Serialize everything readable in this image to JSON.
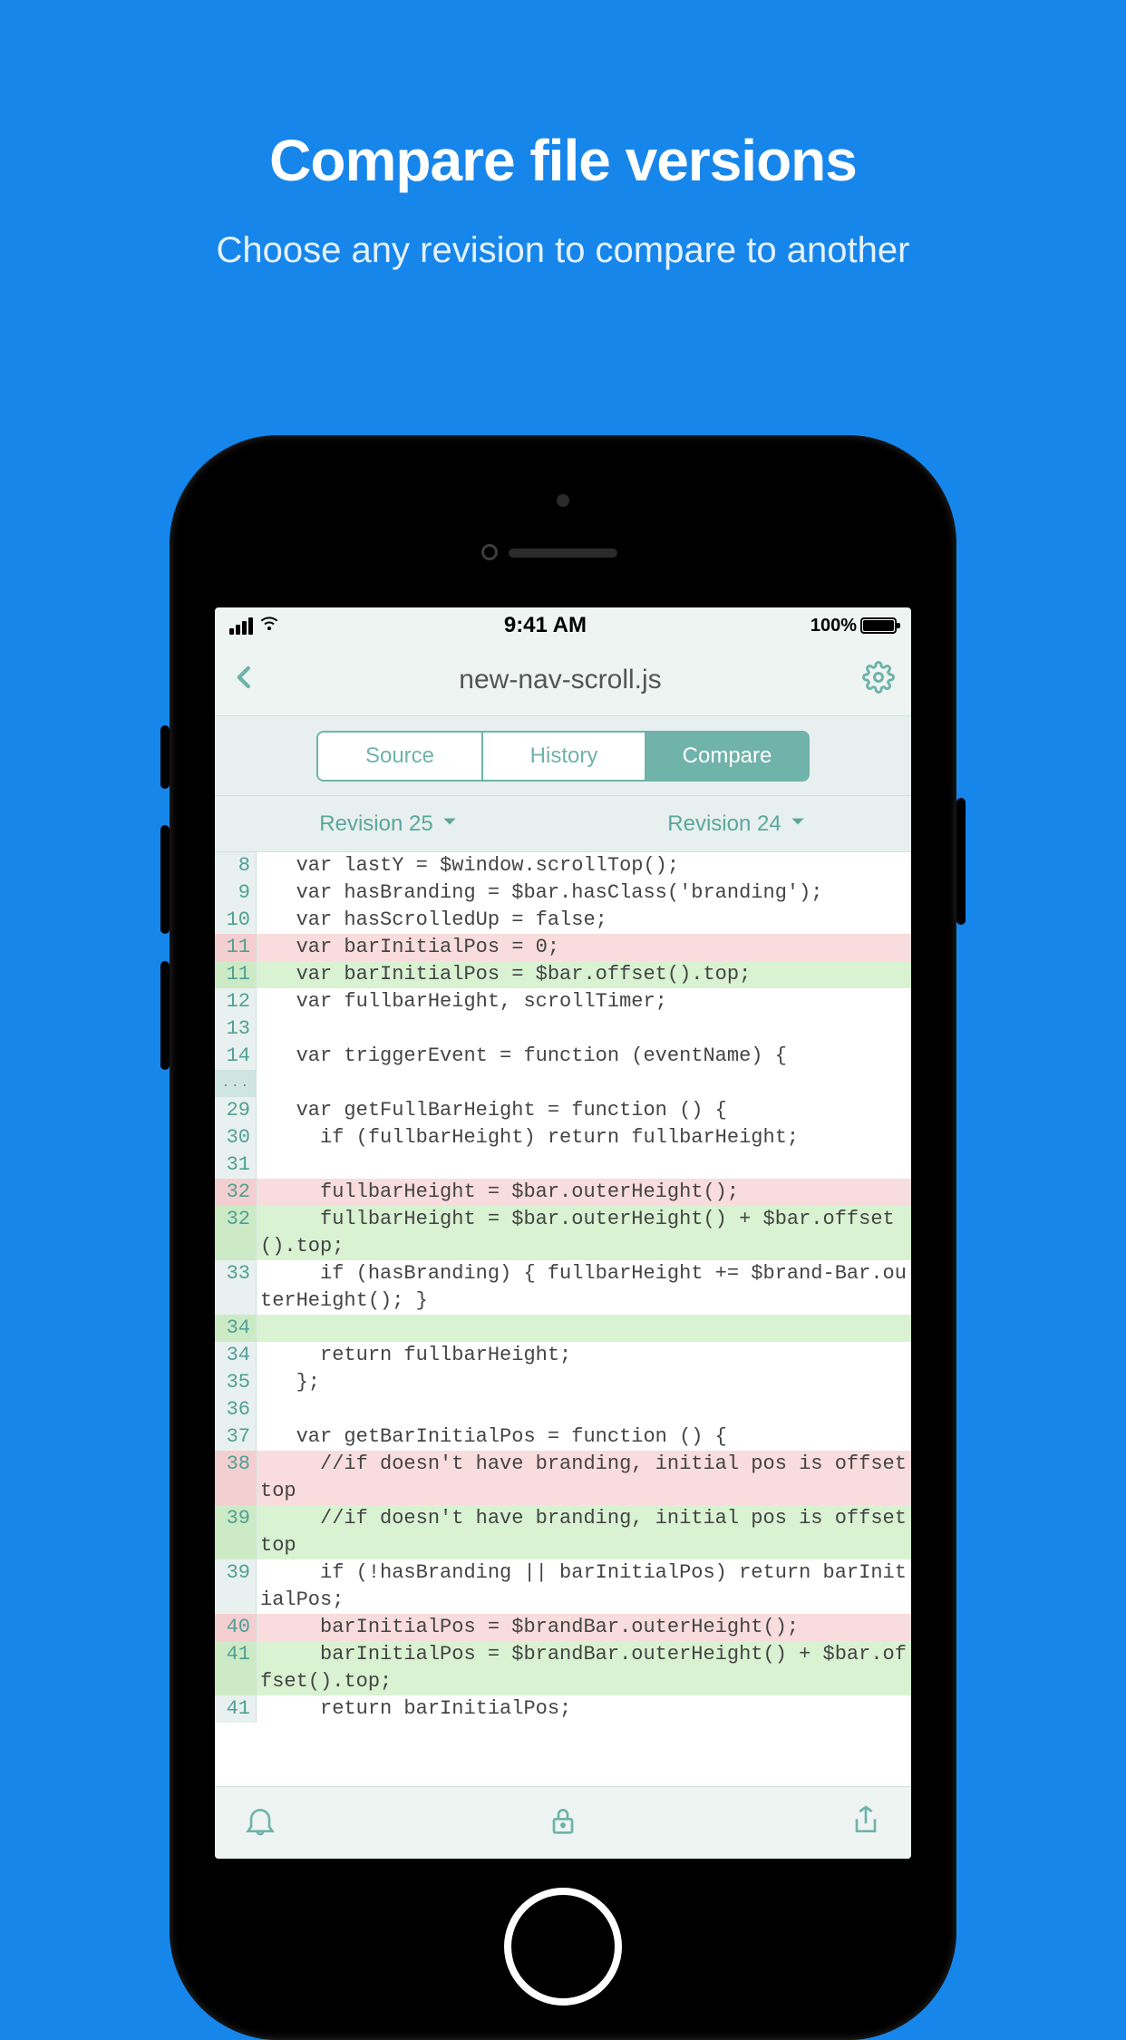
{
  "promo": {
    "title": "Compare file versions",
    "subtitle": "Choose any revision to compare to another"
  },
  "statusbar": {
    "time": "9:41 AM",
    "battery_pct": "100%"
  },
  "nav": {
    "title": "new-nav-scroll.js"
  },
  "tabs": {
    "items": [
      "Source",
      "History",
      "Compare"
    ],
    "active_index": 2
  },
  "revisions": {
    "left": "Revision 25",
    "right": "Revision 24"
  },
  "code": {
    "lines": [
      {
        "n": "8",
        "kind": "ctx",
        "text": "   var lastY = $window.scrollTop();"
      },
      {
        "n": "9",
        "kind": "ctx",
        "text": "   var hasBranding = $bar.hasClass('branding');"
      },
      {
        "n": "10",
        "kind": "ctx",
        "text": "   var hasScrolledUp = false;"
      },
      {
        "n": "11",
        "kind": "del",
        "text": "   var barInitialPos = 0;"
      },
      {
        "n": "11",
        "kind": "add",
        "text": "   var barInitialPos = $bar.offset().top;"
      },
      {
        "n": "12",
        "kind": "ctx",
        "text": "   var fullbarHeight, scrollTimer;"
      },
      {
        "n": "13",
        "kind": "ctx",
        "text": ""
      },
      {
        "n": "14",
        "kind": "ctx",
        "text": "   var triggerEvent = function (eventName) {"
      },
      {
        "n": "...",
        "kind": "ellipsis",
        "text": ""
      },
      {
        "n": "29",
        "kind": "ctx",
        "text": "   var getFullBarHeight = function () {"
      },
      {
        "n": "30",
        "kind": "ctx",
        "text": "     if (fullbarHeight) return fullbarHeight;"
      },
      {
        "n": "31",
        "kind": "ctx",
        "text": ""
      },
      {
        "n": "32",
        "kind": "del",
        "text": "     fullbarHeight = $bar.outerHeight();"
      },
      {
        "n": "32",
        "kind": "add",
        "text": "     fullbarHeight = $bar.outerHeight() + $bar.offset().top;"
      },
      {
        "n": "33",
        "kind": "ctx",
        "text": "     if (hasBranding) { fullbarHeight += $brand-Bar.outerHeight(); }"
      },
      {
        "n": "34",
        "kind": "add",
        "text": ""
      },
      {
        "n": "34",
        "kind": "ctx",
        "text": "     return fullbarHeight;"
      },
      {
        "n": "35",
        "kind": "ctx",
        "text": "   };"
      },
      {
        "n": "36",
        "kind": "ctx",
        "text": ""
      },
      {
        "n": "37",
        "kind": "ctx",
        "text": "   var getBarInitialPos = function () {"
      },
      {
        "n": "38",
        "kind": "del",
        "text": "     //if doesn't have branding, initial pos is offset top"
      },
      {
        "n": "39",
        "kind": "add",
        "text": "     //if doesn't have branding, initial pos is offset top"
      },
      {
        "n": "39",
        "kind": "ctx",
        "text": "     if (!hasBranding || barInitialPos) return barInitialPos;"
      },
      {
        "n": "40",
        "kind": "del",
        "text": "     barInitialPos = $brandBar.outerHeight();"
      },
      {
        "n": "41",
        "kind": "add",
        "text": "     barInitialPos = $brandBar.outerHeight() + $bar.offset().top;"
      },
      {
        "n": "41",
        "kind": "ctx",
        "text": "     return barInitialPos;"
      }
    ]
  },
  "icons": {
    "bell": "bell-icon",
    "lock": "lock-icon",
    "share": "share-icon",
    "gear": "gear-icon",
    "back": "chevron-left-icon",
    "down": "chevron-down-icon"
  }
}
